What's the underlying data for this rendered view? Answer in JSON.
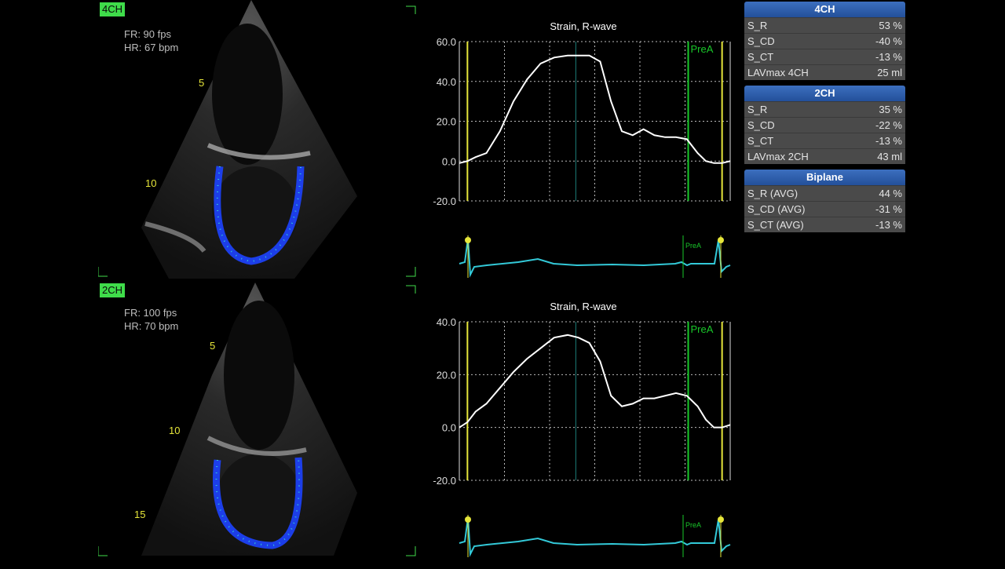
{
  "views": [
    {
      "tag": "4CH",
      "fr": "FR: 90 fps",
      "hr": "HR: 67 bpm",
      "depth_labels": [
        "5",
        "10"
      ]
    },
    {
      "tag": "2CH",
      "fr": "FR: 100 fps",
      "hr": "HR: 70 bpm",
      "depth_labels": [
        "5",
        "10",
        "15"
      ]
    }
  ],
  "colors": {
    "curve": "#ffffff",
    "marker": "#e6e63a",
    "prea": "#19c82a",
    "ecg": "#33c9d8",
    "panel_header": "#2f5fae",
    "panel_row": "#4a4a4a",
    "speckle": "#1d43ff"
  },
  "chart_data": [
    {
      "type": "line",
      "title": "Strain, R-wave",
      "ylim": [
        -20,
        60
      ],
      "yticks": [
        "60.0",
        "40.0",
        "20.0",
        "0.0",
        "-20.0"
      ],
      "marker_label": "PreA",
      "x": [
        0.0,
        0.03,
        0.06,
        0.1,
        0.15,
        0.2,
        0.25,
        0.3,
        0.35,
        0.4,
        0.44,
        0.48,
        0.52,
        0.56,
        0.6,
        0.64,
        0.68,
        0.72,
        0.76,
        0.8,
        0.84,
        0.88,
        0.91,
        0.94,
        0.97,
        1.0
      ],
      "values": [
        -1,
        0,
        2,
        4,
        15,
        30,
        41,
        49,
        52,
        53,
        53,
        53,
        50,
        30,
        15,
        13,
        16,
        13,
        12,
        12,
        11,
        4,
        0,
        -1,
        -1,
        0
      ]
    },
    {
      "type": "line",
      "title": "Strain, R-wave",
      "ylim": [
        -20,
        40
      ],
      "yticks": [
        "40.0",
        "20.0",
        "0.0",
        "-20.0"
      ],
      "marker_label": "PreA",
      "x": [
        0.0,
        0.03,
        0.06,
        0.1,
        0.15,
        0.2,
        0.25,
        0.3,
        0.35,
        0.4,
        0.44,
        0.48,
        0.52,
        0.56,
        0.6,
        0.64,
        0.68,
        0.72,
        0.76,
        0.8,
        0.84,
        0.88,
        0.91,
        0.94,
        0.97,
        1.0
      ],
      "values": [
        0,
        2,
        6,
        9,
        15,
        21,
        26,
        30,
        34,
        35,
        34,
        32,
        25,
        12,
        8,
        9,
        11,
        11,
        12,
        13,
        12,
        8,
        3,
        0,
        0,
        1
      ]
    }
  ],
  "ecg_label": "PreA",
  "panels": [
    {
      "title": "4CH",
      "rows": [
        [
          "S_R",
          "53 %"
        ],
        [
          "S_CD",
          "-40 %"
        ],
        [
          "S_CT",
          "-13 %"
        ],
        [
          "LAVmax 4CH",
          "25 ml"
        ]
      ]
    },
    {
      "title": "2CH",
      "rows": [
        [
          "S_R",
          "35 %"
        ],
        [
          "S_CD",
          "-22 %"
        ],
        [
          "S_CT",
          "-13 %"
        ],
        [
          "LAVmax 2CH",
          "43 ml"
        ]
      ]
    },
    {
      "title": "Biplane",
      "rows": [
        [
          "S_R (AVG)",
          "44 %"
        ],
        [
          "S_CD (AVG)",
          "-31 %"
        ],
        [
          "S_CT (AVG)",
          "-13 %"
        ]
      ]
    }
  ]
}
